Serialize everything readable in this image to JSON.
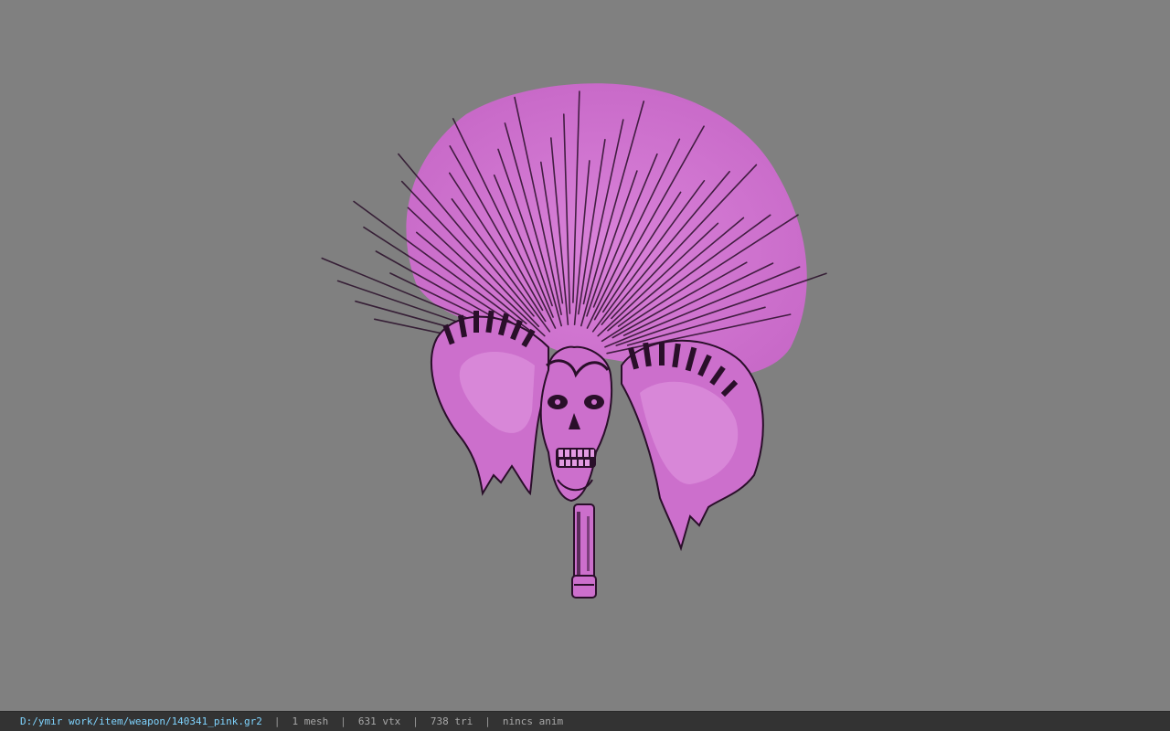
{
  "viewer": {
    "background_color": "#808080"
  },
  "model": {
    "primary_color": "#cc6fcc",
    "shadow_color": "#2a0f2a",
    "highlight_color": "#e29ae2"
  },
  "status_bar": {
    "file_path": "D:/ymir work/item/weapon/140341_pink.gr2",
    "separator": "|",
    "mesh_count": "1 mesh",
    "vertex_count": "631 vtx",
    "triangle_count": "738 tri",
    "animation": "nincs anim",
    "path_color": "#7fd4ff",
    "text_color": "#a8a8a8",
    "background_color": "#333333"
  }
}
